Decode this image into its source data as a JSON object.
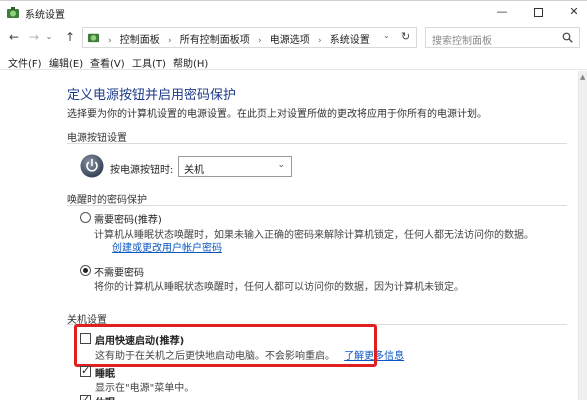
{
  "window": {
    "title": "系统设置",
    "minimize": "—",
    "close": "✕"
  },
  "nav": {
    "back": "←",
    "forward": "→",
    "up": "↑",
    "recent": "⌄",
    "refresh": "↻",
    "breadcrumbs": [
      "控制面板",
      "所有控制面板项",
      "电源选项",
      "系统设置"
    ],
    "separator": "›",
    "search_placeholder": "搜索控制面板"
  },
  "menu": {
    "items": [
      "文件(F)",
      "编辑(E)",
      "查看(V)",
      "工具(T)",
      "帮助(H)"
    ]
  },
  "page": {
    "heading": "定义电源按钮并启用密码保护",
    "subtitle": "选择要为你的计算机设置的电源设置。在此页上对设置所做的更改将应用于你所有的电源计划。",
    "power_section": {
      "label": "电源按钮设置",
      "button_label": "按电源按钮时:",
      "selected": "关机"
    },
    "password_section": {
      "label": "唤醒时的密码保护",
      "opt1_title": "需要密码(推荐)",
      "opt1_desc": "计算机从睡眠状态唤醒时，如果未输入正确的密码来解除计算机锁定，任何人都无法访问你的数据。",
      "opt1_link": "创建或更改用户帐户密码",
      "opt2_title": "不需要密码",
      "opt2_desc": "将你的计算机从睡眠状态唤醒时，任何人都可以访问你的数据，因为计算机未锁定。"
    },
    "shutdown_section": {
      "label": "关机设置",
      "fast_title": "启用快速启动(推荐)",
      "fast_desc": "这有助于在关机之后更快地启动电脑。不会影响重启。",
      "fast_link": "了解更多信息",
      "sleep_title": "睡眠",
      "sleep_desc": "显示在\"电源\"菜单中。",
      "hibernate_title": "休眠"
    }
  },
  "colors": {
    "heading": "#1e3a8a",
    "link": "#0b57c2",
    "highlight": "#e02020"
  }
}
